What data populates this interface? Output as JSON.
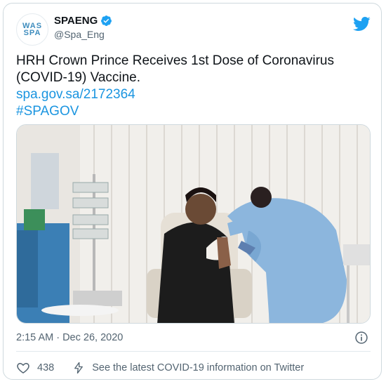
{
  "author": {
    "display_name": "SPAENG",
    "handle": "@Spa_Eng",
    "avatar_text_top": "WAS",
    "avatar_text_bottom": "SPA"
  },
  "tweet": {
    "text_line1": "HRH Crown Prince Receives 1st Dose of Coronavirus",
    "text_line2": "(COVID-19) Vaccine.",
    "link": "spa.gov.sa/2172364",
    "hashtag": "#SPAGOV"
  },
  "timestamp": "2:15 AM · Dec 26, 2020",
  "footer": {
    "like_count": "438",
    "info_text": "See the latest COVID-19 information on Twitter"
  },
  "colors": {
    "link": "#1b95e0",
    "twitter_blue": "#1da1f2",
    "secondary_text": "#536471"
  },
  "icons": [
    "verified-badge-icon",
    "twitter-bird-icon",
    "info-icon",
    "heart-icon",
    "lightning-icon"
  ]
}
